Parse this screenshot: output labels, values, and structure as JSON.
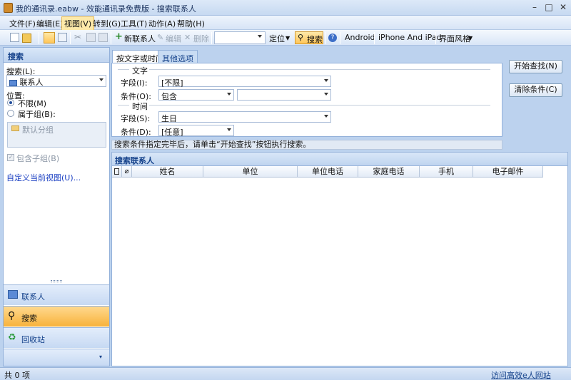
{
  "window": {
    "title": "我的通讯录.eabw - 效能通讯录免费版 - 搜索联系人",
    "min": "–",
    "max": "□",
    "close": "✕"
  },
  "menu": [
    "文件(F)",
    "编辑(E)",
    "视图(V)",
    "转到(G)",
    "工具(T)",
    "动作(A)",
    "帮助(H)"
  ],
  "toolbar": {
    "new_contact": "新联系人",
    "edit": "编辑",
    "delete": "删除",
    "locate": "定位",
    "search": "搜索",
    "android": "Android",
    "iphone": "iPhone And iPad",
    "skin": "界面风格"
  },
  "left": {
    "header": "搜索",
    "search_label": "搜索(L):",
    "search_value": "联系人",
    "position_label": "位置:",
    "opt_any": "不限(M)",
    "opt_group": "属于组(B):",
    "default_group": "默认分组",
    "include_sub": "包含子组(B)",
    "customize": "自定义当前视图(U)...",
    "nav": [
      "联系人",
      "搜索",
      "回收站"
    ]
  },
  "tabs": [
    "按文字或时间",
    "其他选项"
  ],
  "form": {
    "text_section": "文字",
    "field_label": "字段(I):",
    "field_value": "[不限]",
    "cond_label": "条件(O):",
    "cond_value": "包含",
    "time_section": "时间",
    "time_field_label": "字段(S):",
    "time_field_value": "生日",
    "time_cond_label": "条件(D):",
    "time_cond_value": "[任意]"
  },
  "buttons": {
    "start": "开始查找(N)",
    "clear": "清除条件(C)"
  },
  "hint": "搜索条件指定完毕后，请单击“开始查找”按钮执行搜索。",
  "results": {
    "title": "搜索联系人",
    "columns": [
      "姓名",
      "单位",
      "单位电话",
      "家庭电话",
      "手机",
      "电子邮件"
    ]
  },
  "status": {
    "count": "共 0 项",
    "link": "访问高效e人网站"
  }
}
